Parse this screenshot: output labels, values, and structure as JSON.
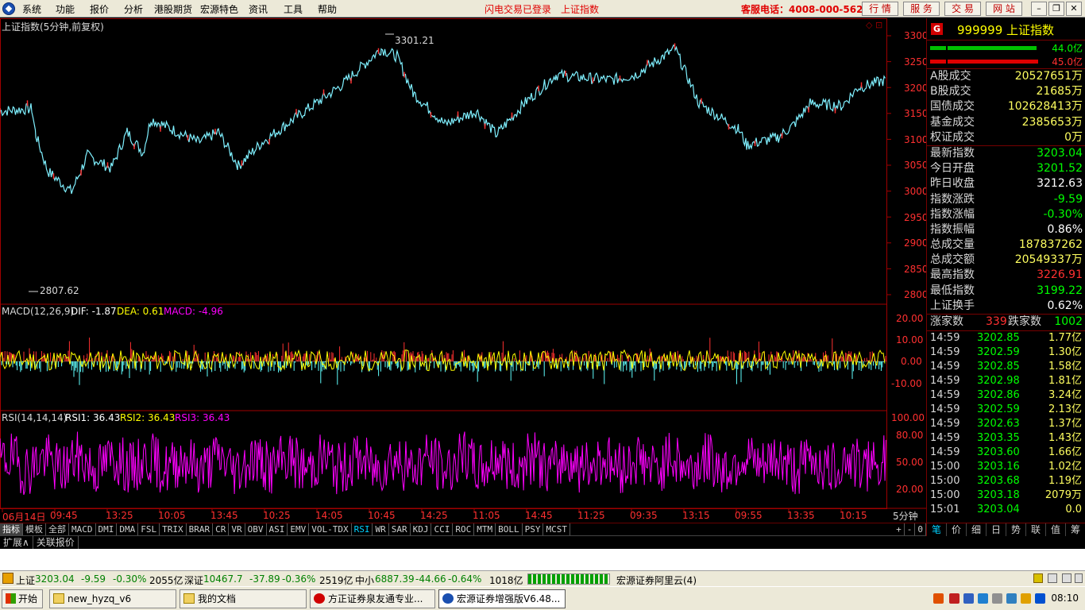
{
  "menubar": {
    "items": [
      "系统",
      "功能",
      "报价",
      "分析",
      "港股期货",
      "宏源特色",
      "资讯",
      "工具",
      "帮助"
    ],
    "status_login": "闪电交易已登录",
    "status_index": "上证指数",
    "hotline": "客服电话：4008-000-562",
    "right_buttons": [
      "行 情",
      "服 务",
      "交 易",
      "网 站"
    ]
  },
  "chart": {
    "title": "上证指数(5分钟,前复权)",
    "high_label": "3301.21",
    "low_label": "2807.62",
    "price_axis": [
      "3300",
      "3250",
      "3200",
      "3150",
      "3100",
      "3050",
      "3000",
      "2950",
      "2900",
      "2850",
      "2800"
    ],
    "macd": {
      "label": "MACD(12,26,9)",
      "dif": "DIF: -1.87",
      "dea": "DEA: 0.61",
      "macd": "MACD: -4.96",
      "axis": [
        "20.00",
        "10.00",
        "0.00",
        "-10.00"
      ]
    },
    "rsi": {
      "label": "RSI(14,14,14)",
      "rsi1": "RSI1: 36.43",
      "rsi2": "RSI2: 36.43",
      "rsi3": "RSI3: 36.43",
      "axis": [
        "100.00",
        "80.00",
        "50.00",
        "20.00"
      ]
    },
    "time_axis": [
      "06月14日",
      "09:45",
      "13:25",
      "10:05",
      "13:45",
      "10:25",
      "14:05",
      "10:45",
      "14:25",
      "11:05",
      "14:45",
      "11:25",
      "09:35",
      "13:15",
      "09:55",
      "13:35",
      "10:15"
    ],
    "period": "5分钟",
    "colors": {
      "price": "#7ff0ff",
      "axis": "#a00000",
      "up": "#ff3030",
      "down": "#60ffff",
      "dif": "#ffffff",
      "dea": "#ffff00",
      "macd": "#ff00ff",
      "rsi": "#ff00ff"
    }
  },
  "indicator_tabs": {
    "items": [
      "指标",
      "模板",
      "全部",
      "MACD",
      "DMI",
      "DMA",
      "FSL",
      "TRIX",
      "BRAR",
      "CR",
      "VR",
      "OBV",
      "ASI",
      "EMV",
      "VOL-TDX",
      "RSI",
      "WR",
      "SAR",
      "KDJ",
      "CCI",
      "ROC",
      "MTM",
      "BOLL",
      "PSY",
      "MCST"
    ],
    "zoom": [
      "+",
      "-",
      "0"
    ]
  },
  "ext_tabs": [
    "扩展∧",
    "关联报价"
  ],
  "right_panel": {
    "badge": "G",
    "code": "999999 上证指数",
    "vol_up": "44.0亿",
    "vol_down": "45.0亿",
    "stats": [
      {
        "k": "A股成交",
        "v": "20527651万",
        "c": "#ffff60"
      },
      {
        "k": "B股成交",
        "v": "21685万",
        "c": "#ffff60"
      },
      {
        "k": "国债成交",
        "v": "102628413万",
        "c": "#ffff60"
      },
      {
        "k": "基金成交",
        "v": "2385653万",
        "c": "#ffff60"
      },
      {
        "k": "权证成交",
        "v": "0万",
        "c": "#ffff60"
      }
    ],
    "quote": [
      {
        "k": "最新指数",
        "v": "3203.04",
        "c": "#00ff00"
      },
      {
        "k": "今日开盘",
        "v": "3201.52",
        "c": "#00ff00"
      },
      {
        "k": "昨日收盘",
        "v": "3212.63",
        "c": "#ffffff"
      },
      {
        "k": "指数涨跌",
        "v": "-9.59",
        "c": "#00ff00"
      },
      {
        "k": "指数涨幅",
        "v": "-0.30%",
        "c": "#00ff00"
      },
      {
        "k": "指数振幅",
        "v": "0.86%",
        "c": "#ffffff"
      },
      {
        "k": "总成交量",
        "v": "187837262",
        "c": "#ffff60"
      },
      {
        "k": "总成交额",
        "v": "20549337万",
        "c": "#ffff60"
      },
      {
        "k": "最高指数",
        "v": "3226.91",
        "c": "#ff3030"
      },
      {
        "k": "最低指数",
        "v": "3199.22",
        "c": "#00ff00"
      },
      {
        "k": "上证换手",
        "v": "0.62%",
        "c": "#ffffff"
      }
    ],
    "rise_label": "涨家数",
    "rise_count": "339",
    "fall_label": "跌家数",
    "fall_count": "1002",
    "ticks": [
      {
        "t": "14:59",
        "p": "3202.85",
        "a": "1.77亿"
      },
      {
        "t": "14:59",
        "p": "3202.59",
        "a": "1.30亿"
      },
      {
        "t": "14:59",
        "p": "3202.85",
        "a": "1.58亿"
      },
      {
        "t": "14:59",
        "p": "3202.98",
        "a": "1.81亿"
      },
      {
        "t": "14:59",
        "p": "3202.86",
        "a": "3.24亿"
      },
      {
        "t": "14:59",
        "p": "3202.59",
        "a": "2.13亿"
      },
      {
        "t": "14:59",
        "p": "3202.63",
        "a": "1.37亿"
      },
      {
        "t": "14:59",
        "p": "3203.35",
        "a": "1.43亿"
      },
      {
        "t": "14:59",
        "p": "3203.60",
        "a": "1.66亿"
      },
      {
        "t": "15:00",
        "p": "3203.16",
        "a": "1.02亿"
      },
      {
        "t": "15:00",
        "p": "3203.68",
        "a": "1.19亿"
      },
      {
        "t": "15:00",
        "p": "3203.18",
        "a": "2079万"
      },
      {
        "t": "15:01",
        "p": "3203.04",
        "a": "0.0"
      }
    ],
    "tabs": [
      "笔",
      "价",
      "细",
      "日",
      "势",
      "联",
      "值",
      "筹"
    ]
  },
  "statusbar": {
    "sh_label": "上证",
    "sh_price": "3203.04",
    "sh_chg": "-9.59",
    "sh_pct": "-0.30%",
    "sh_amt": "2055亿",
    "sz_label": "深证",
    "sz_price": "10467.7",
    "sz_chg": "-37.89",
    "sz_pct": "-0.36%",
    "sz_amt": "2519亿",
    "zx_label": "中小",
    "zx_price": "6887.39",
    "zx_chg": "-44.66",
    "zx_pct": "-0.64%",
    "zx_amt": "1018亿",
    "server": "宏源证券阿里云(4)"
  },
  "taskbar": {
    "start": "开始",
    "tasks": [
      "new_hyzq_v6",
      "我的文档",
      "方正证券泉友通专业...",
      "宏源证券增强版V6.48..."
    ],
    "clock": "08:10"
  }
}
